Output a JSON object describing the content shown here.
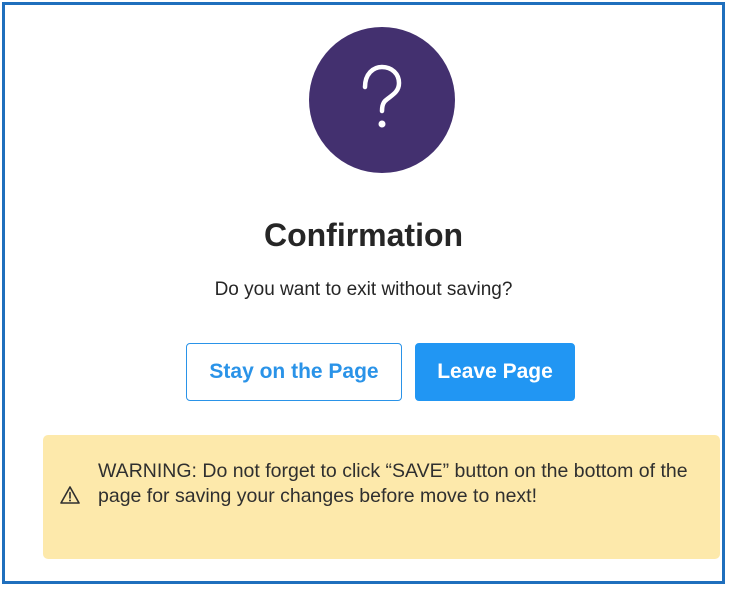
{
  "dialog": {
    "icon": "question-mark-icon",
    "title": "Confirmation",
    "message": "Do you want to exit without saving?",
    "buttons": {
      "stay_label": "Stay on the Page",
      "leave_label": "Leave Page"
    },
    "warning": {
      "icon": "warning-triangle-icon",
      "text": "WARNING: Do not forget to click “SAVE” button on the bottom of the page for saving your changes before move to next!"
    }
  },
  "colors": {
    "border": "#1f6fbd",
    "icon_circle": "#43306f",
    "primary": "#2196f3",
    "warning_bg": "#fde9ab"
  }
}
